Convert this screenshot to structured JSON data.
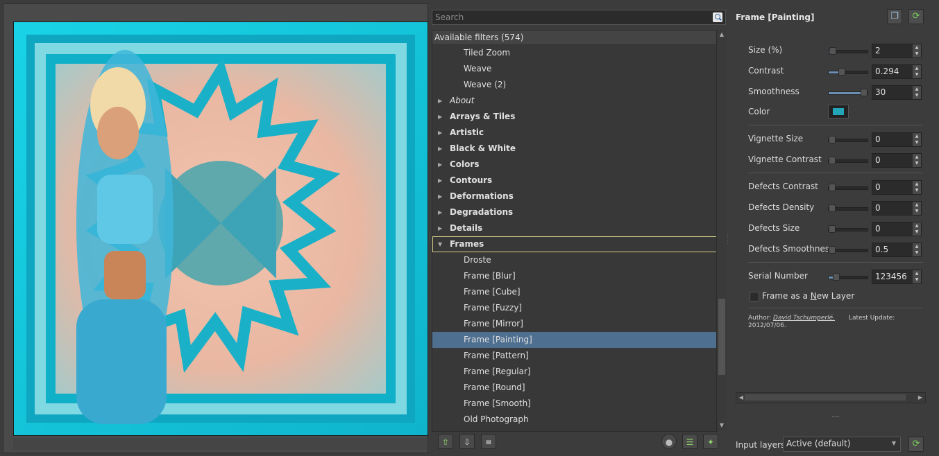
{
  "search": {
    "placeholder": "Search"
  },
  "filters": {
    "header": "Available filters (574)",
    "rows": [
      {
        "label": "Tiled Zoom",
        "kind": "child"
      },
      {
        "label": "Weave",
        "kind": "child"
      },
      {
        "label": "Weave (2)",
        "kind": "child"
      },
      {
        "label": "About",
        "kind": "cat",
        "italic": true
      },
      {
        "label": "Arrays & Tiles",
        "kind": "cat"
      },
      {
        "label": "Artistic",
        "kind": "cat"
      },
      {
        "label": "Black & White",
        "kind": "cat"
      },
      {
        "label": "Colors",
        "kind": "cat"
      },
      {
        "label": "Contours",
        "kind": "cat"
      },
      {
        "label": "Deformations",
        "kind": "cat"
      },
      {
        "label": "Degradations",
        "kind": "cat"
      },
      {
        "label": "Details",
        "kind": "cat"
      },
      {
        "label": "Frames",
        "kind": "cat",
        "expanded": true
      },
      {
        "label": "Droste",
        "kind": "child"
      },
      {
        "label": "Frame [Blur]",
        "kind": "child"
      },
      {
        "label": "Frame [Cube]",
        "kind": "child"
      },
      {
        "label": "Frame [Fuzzy]",
        "kind": "child"
      },
      {
        "label": "Frame [Mirror]",
        "kind": "child"
      },
      {
        "label": "Frame [Painting]",
        "kind": "child",
        "selected": true
      },
      {
        "label": "Frame [Pattern]",
        "kind": "child"
      },
      {
        "label": "Frame [Regular]",
        "kind": "child"
      },
      {
        "label": "Frame [Round]",
        "kind": "child"
      },
      {
        "label": "Frame [Smooth]",
        "kind": "child"
      },
      {
        "label": "Old Photograph",
        "kind": "child"
      }
    ]
  },
  "toolbar": {
    "add_fav_icon": "add-favorite-icon",
    "remove_fav_icon": "remove-favorite-icon",
    "rename_icon": "rename-icon",
    "refresh_icon": "refresh-icon",
    "expand_icon": "expand-collapse-icon",
    "update_icon": "update-filters-icon"
  },
  "params": {
    "title": "Frame [Painting]",
    "size": {
      "label": "Size (%)",
      "value": "2",
      "fraction": 0.02
    },
    "contrast": {
      "label": "Contrast",
      "value": "0.294",
      "fraction": 0.294
    },
    "smoothness": {
      "label": "Smoothness",
      "value": "30",
      "fraction": 1.0
    },
    "color": {
      "label": "Color",
      "value": "#21a5b7"
    },
    "vignette_size": {
      "label": "Vignette Size",
      "value": "0",
      "fraction": 0
    },
    "vignette_contrast": {
      "label": "Vignette Contrast",
      "value": "0",
      "fraction": 0
    },
    "defects_contrast": {
      "label": "Defects Contrast",
      "value": "0",
      "fraction": 0
    },
    "defects_density": {
      "label": "Defects Density",
      "value": "0",
      "fraction": 0
    },
    "defects_size": {
      "label": "Defects Size",
      "value": "0",
      "fraction": 0
    },
    "defects_smoothness": {
      "label": "Defects Smoothness",
      "value": "0.5",
      "fraction": 0
    },
    "serial_number": {
      "label": "Serial Number",
      "value": "123456",
      "fraction": 0.12
    },
    "new_layer": {
      "label_pre": "Frame as a ",
      "label_key": "N",
      "label_post": "ew Layer",
      "checked": false
    },
    "author_prefix": "Author: ",
    "author_name": "David Tschumperlé.",
    "update_label": "Latest Update:",
    "update_date": "2012/07/06."
  },
  "input_layers": {
    "label": "Input layers",
    "value": "Active (default)"
  },
  "colors": {
    "selection": "#4e6f8f",
    "accent": "#21a5b7",
    "frame_outline": "#d8d28c"
  }
}
